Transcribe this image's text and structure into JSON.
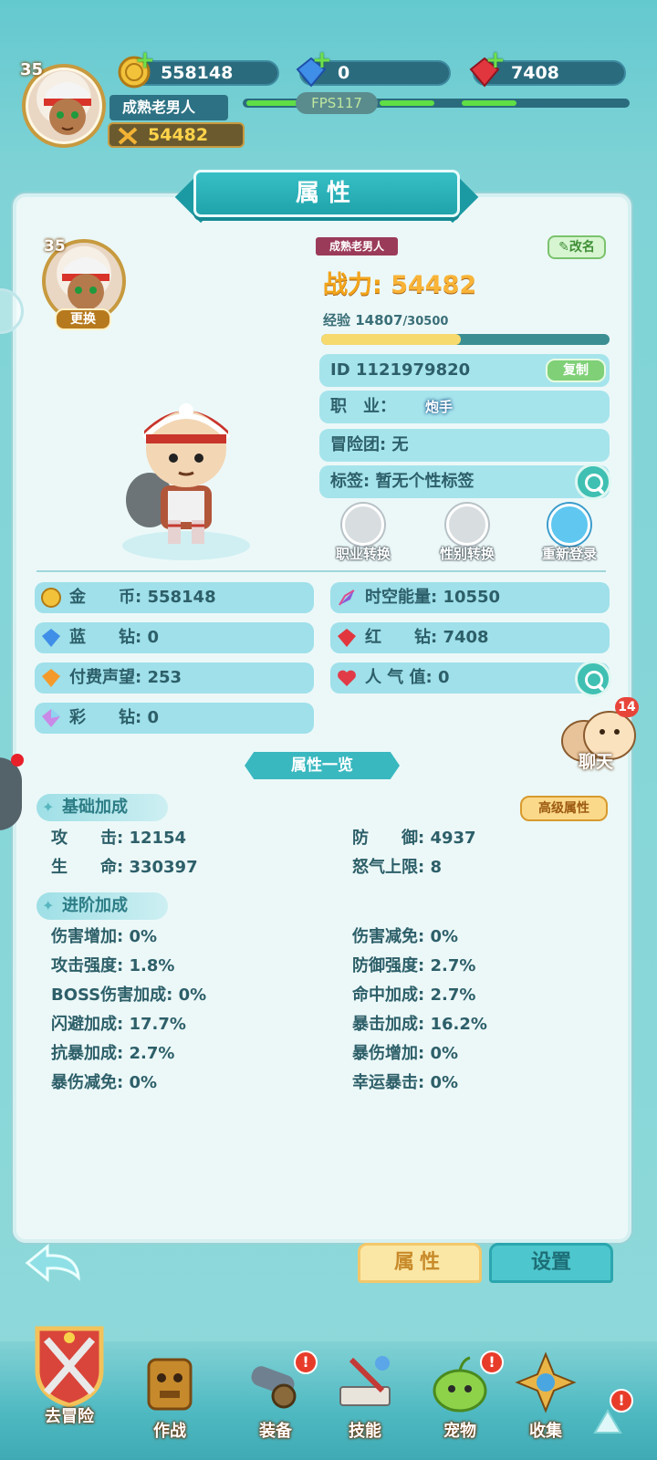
{
  "hud": {
    "level": "35",
    "gold": "558148",
    "blue_diamond": "0",
    "red_diamond": "7408",
    "player_name": "成熟老男人",
    "combat_power": "54482",
    "fps": "FPS117"
  },
  "panel": {
    "title": "属性",
    "portrait_level": "35",
    "swap_label": "更换",
    "name_tag": "成熟老男人",
    "rename_label": "改名",
    "power_label": "战力:",
    "power_value": "54482",
    "exp_label": "经验",
    "exp_current": "14807",
    "exp_max": "/30500",
    "exp_progress": 0.485,
    "id_text": "ID 1121979820",
    "copy_label": "复制",
    "job_label": "职　业：",
    "job_value": "炮手",
    "team_label": "冒险团: 无",
    "tag_label": "标签:",
    "tag_value": "暂无个性标签",
    "actions": [
      {
        "label": "职业转换",
        "icon": "job-change-icon"
      },
      {
        "label": "性别转换",
        "icon": "gender-change-icon"
      },
      {
        "label": "重新登录",
        "icon": "relogin-icon"
      }
    ]
  },
  "currencies": {
    "gold": "金　　币: 558148",
    "spacetime": "时空能量: 10550",
    "blue": "蓝　　钻: 0",
    "red": "红　　钻: 7408",
    "paid_fame": "付费声望: 253",
    "popularity": "人 气 值: 0",
    "color_diamond": "彩　　钻: 0"
  },
  "stats": {
    "section_title": "属性一览",
    "basic_title": "基础加成",
    "advanced_button": "高级属性",
    "basic": [
      {
        "left": "攻　　击: 12154",
        "right": "防　　御: 4937"
      },
      {
        "left": "生　　命: 330397",
        "right": "怒气上限: 8"
      }
    ],
    "adv_title": "进阶加成",
    "advanced": [
      {
        "left": "伤害增加: 0%",
        "right": "伤害减免: 0%"
      },
      {
        "left": "攻击强度: 1.8%",
        "right": "防御强度: 2.7%"
      },
      {
        "left": "BOSS伤害加成: 0%",
        "right": "命中加成: 2.7%"
      },
      {
        "left": "闪避加成: 17.7%",
        "right": "暴击加成: 16.2%"
      },
      {
        "left": "抗暴加成: 2.7%",
        "right": "暴伤增加: 0%"
      },
      {
        "left": "暴伤减免: 0%",
        "right": "幸运暴击: 0%"
      }
    ]
  },
  "chat": {
    "label": "聊天",
    "count": "14"
  },
  "tabs": {
    "attr": "属性",
    "settings": "设置"
  },
  "nav": [
    {
      "label": "去冒险"
    },
    {
      "label": "作战"
    },
    {
      "label": "装备"
    },
    {
      "label": "技能"
    },
    {
      "label": "宠物"
    },
    {
      "label": "收集"
    }
  ],
  "colors": {
    "accent": "#37bfc6",
    "panel_bg": "#ecf8f8",
    "power_text": "#f9b437"
  }
}
